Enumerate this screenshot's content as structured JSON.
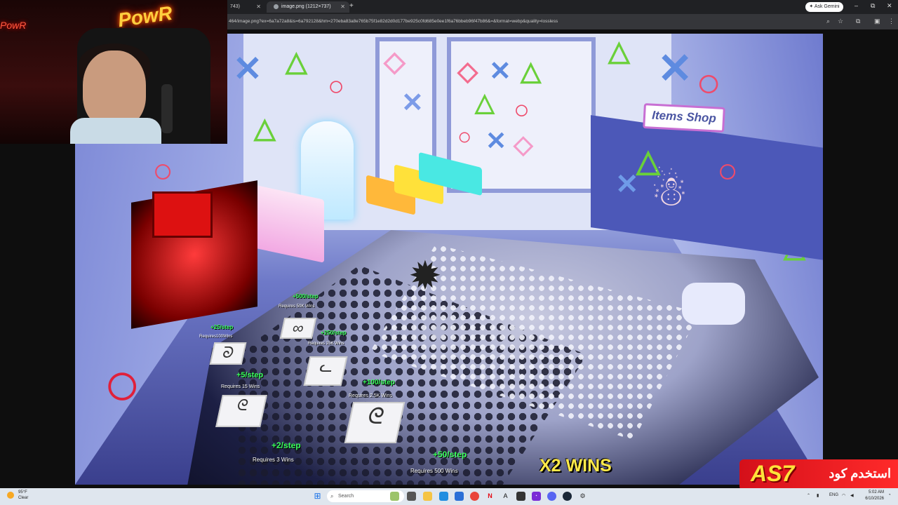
{
  "browser": {
    "tabs": [
      {
        "label": "743)",
        "active": false
      },
      {
        "label": "image.png (1212×737)",
        "active": true
      }
    ],
    "new_tab_label": "+",
    "ask_gemini": "Ask Gemini",
    "url": "464/image.png?ex=6a7a72a8&is=6a792128&hm=270eba83a8e765b75f1e82d2d0d177be925c0fd685e0ee1f6a76bbeb96f47b86&=&format=webp&quality=lossless",
    "window_controls": {
      "minimize": "–",
      "maximize": "⧉",
      "close": "✕"
    }
  },
  "webcam": {
    "neon_sign": "PowR",
    "neon_sign_left": "PowR"
  },
  "game": {
    "shop_sign": "Items Shop",
    "steps": [
      {
        "gain": "+500/step",
        "req": "Requires 50K Wins"
      },
      {
        "gain": "+25/step",
        "req": "Requires100Wins"
      },
      {
        "gain": "+250/step",
        "req": "Requires 15K Wins"
      },
      {
        "gain": "+5/step",
        "req": "Requires 15 Wins"
      },
      {
        "gain": "+100/step",
        "req": "Requires 2.5K Wins"
      },
      {
        "gain": "+2/step",
        "req": "Requires 3 Wins"
      },
      {
        "gain": "+50/step",
        "req": "Requires 500 Wins"
      }
    ],
    "x2_wins": "X2 WINS"
  },
  "promo": {
    "code": "AS7",
    "text": "استخدم كود"
  },
  "taskbar": {
    "weather_temp": "95°F",
    "weather_cond": "Clear",
    "search_placeholder": "Search",
    "language": "ENG",
    "time": "5:02 AM",
    "date": "6/10/2026"
  }
}
